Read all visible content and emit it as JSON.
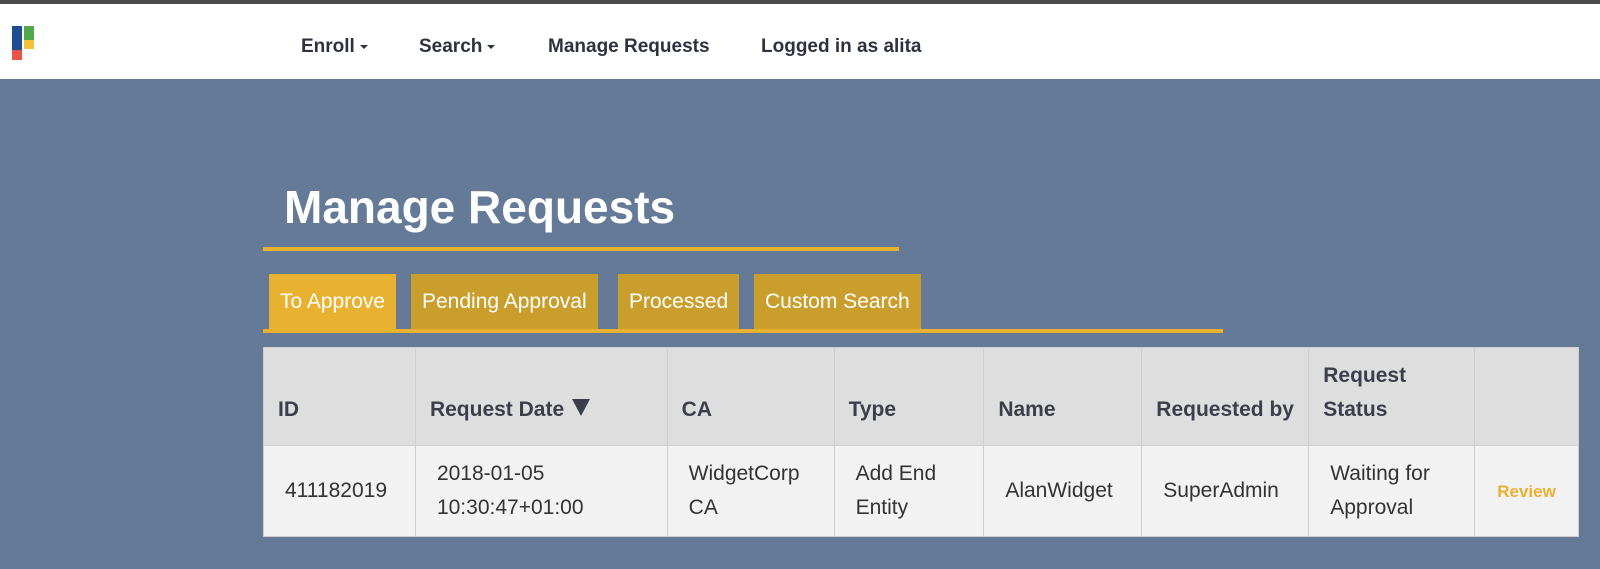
{
  "nav": {
    "enroll_label": "Enroll",
    "search_label": "Search",
    "manage_requests_label": "Manage Requests",
    "logged_in_label": "Logged in as alita"
  },
  "page": {
    "title": "Manage Requests"
  },
  "tabs": [
    {
      "label": "To Approve",
      "active": true
    },
    {
      "label": "Pending Approval",
      "active": false
    },
    {
      "label": "Processed",
      "active": false
    },
    {
      "label": "Custom Search",
      "active": false
    }
  ],
  "table": {
    "headers": {
      "id": "ID",
      "request_date": "Request Date",
      "ca": "CA",
      "type": "Type",
      "name": "Name",
      "requested_by": "Requested by",
      "request_status": "Request Status"
    },
    "rows": [
      {
        "id": "411182019",
        "request_date": "2018-01-05 10:30:47+01:00",
        "ca": "WidgetCorp CA",
        "type": "Add End Entity",
        "name": "AlanWidget",
        "requested_by": "SuperAdmin",
        "request_status": "Waiting for Approval",
        "action": "Review"
      }
    ]
  },
  "colors": {
    "background": "#647a96",
    "accent": "#e8b12f",
    "tab_inactive": "#c99e2c"
  }
}
